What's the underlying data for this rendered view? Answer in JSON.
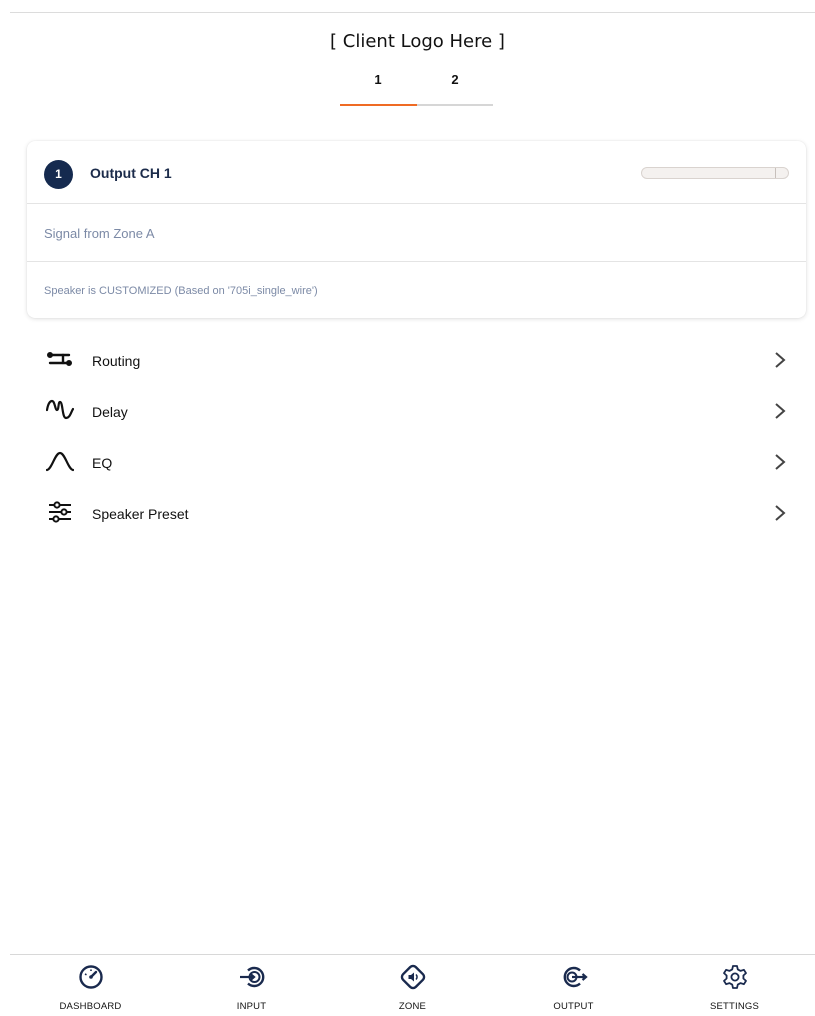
{
  "header": {
    "logo_text": "[ Client Logo Here ]"
  },
  "tabs": [
    {
      "label": "1",
      "active": true
    },
    {
      "label": "2",
      "active": false
    }
  ],
  "channel": {
    "number": "1",
    "title": "Output CH 1",
    "level_fraction": 0.0,
    "signal_text": "Signal from Zone A",
    "speaker_text": "Speaker is CUSTOMIZED (Based on '705i_single_wire')"
  },
  "menu": [
    {
      "label": "Routing",
      "icon": "routing-icon"
    },
    {
      "label": "Delay",
      "icon": "delay-icon"
    },
    {
      "label": "EQ",
      "icon": "eq-icon"
    },
    {
      "label": "Speaker Preset",
      "icon": "speaker-preset-icon"
    }
  ],
  "nav": [
    {
      "label": "DASHBOARD",
      "icon": "dashboard-icon"
    },
    {
      "label": "INPUT",
      "icon": "input-icon"
    },
    {
      "label": "ZONE",
      "icon": "zone-icon"
    },
    {
      "label": "OUTPUT",
      "icon": "output-icon"
    },
    {
      "label": "SETTINGS",
      "icon": "settings-icon"
    }
  ],
  "colors": {
    "accent": "#ef6b24",
    "badge": "#152a4f",
    "muted_text": "#7c8aa6",
    "nav_icon": "#1a2a4e"
  }
}
